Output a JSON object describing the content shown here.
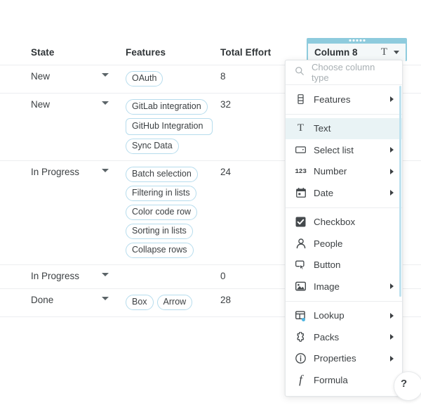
{
  "table": {
    "columns": [
      {
        "key": "state",
        "label": "State"
      },
      {
        "key": "features",
        "label": "Features"
      },
      {
        "key": "effort",
        "label": "Total Effort"
      }
    ],
    "rows": [
      {
        "state": "New",
        "features": [
          "OAuth"
        ],
        "effort": "8"
      },
      {
        "state": "New",
        "features": [
          "GitLab integration",
          "GitHub Integration",
          "Sync Data"
        ],
        "effort": "32"
      },
      {
        "state": "In Progress",
        "features": [
          "Batch selection",
          "Filtering in lists",
          "Color code row",
          "Sorting in lists",
          "Collapse rows"
        ],
        "effort": "24"
      },
      {
        "state": "In Progress",
        "features": [],
        "effort": "0"
      },
      {
        "state": "Done",
        "features": [
          "Box",
          "Arrow"
        ],
        "effort": "28"
      }
    ]
  },
  "column_header": {
    "name": "Column 8",
    "type_icon": "T",
    "type_icon_name": "text-type-icon",
    "chevron_icon": "chevron-down-icon",
    "drag_handle_icon": "drag-handle-icon",
    "accent_color": "#8ecbdd",
    "inner_background": "#f4f8f9"
  },
  "menu": {
    "search": {
      "placeholder": "Choose column type",
      "icon": "search-icon"
    },
    "highlight_color": "#e9f3f5",
    "groups": [
      {
        "items": [
          {
            "label": "Features",
            "icon": "table-column-icon",
            "submenu": true
          }
        ]
      },
      {
        "items": [
          {
            "label": "Text",
            "icon": "text-icon",
            "submenu": false,
            "active": true
          },
          {
            "label": "Select list",
            "icon": "select-list-icon",
            "submenu": true
          },
          {
            "label": "Number",
            "icon": "number-123-icon",
            "submenu": true
          },
          {
            "label": "Date",
            "icon": "calendar-icon",
            "submenu": true
          }
        ]
      },
      {
        "items": [
          {
            "label": "Checkbox",
            "icon": "checkbox-icon",
            "submenu": false
          },
          {
            "label": "People",
            "icon": "person-icon",
            "submenu": false
          },
          {
            "label": "Button",
            "icon": "button-icon",
            "submenu": false
          },
          {
            "label": "Image",
            "icon": "image-icon",
            "submenu": true
          }
        ]
      },
      {
        "items": [
          {
            "label": "Lookup",
            "icon": "lookup-icon",
            "submenu": true,
            "badge_dot": "#4db4e0"
          },
          {
            "label": "Packs",
            "icon": "packs-icon",
            "submenu": true
          },
          {
            "label": "Properties",
            "icon": "info-circle-icon",
            "submenu": true
          },
          {
            "label": "Formula",
            "icon": "formula-icon",
            "submenu": false
          }
        ]
      }
    ]
  },
  "fab": {
    "icon": "help-icon",
    "label": "?"
  }
}
